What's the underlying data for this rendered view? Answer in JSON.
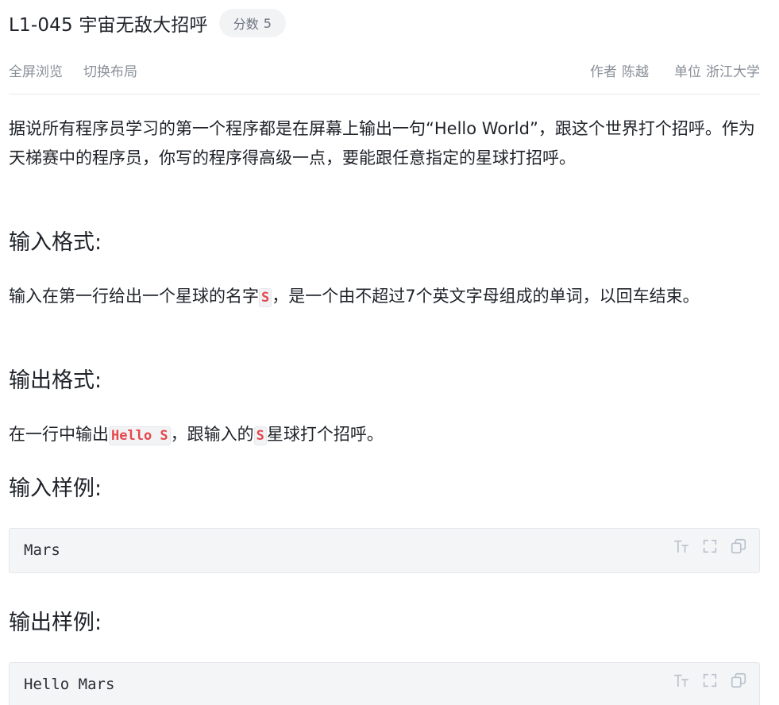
{
  "problem": {
    "title": "L1-045 宇宙无敌大招呼",
    "score_label": "分数",
    "score_value": "5"
  },
  "toolbar": {
    "fullscreen_label": "全屏浏览",
    "switch_layout_label": "切换布局"
  },
  "meta": {
    "author_label": "作者",
    "author_value": "陈越",
    "unit_label": "单位",
    "unit_value": "浙江大学"
  },
  "description": {
    "text": "据说所有程序员学习的第一个程序都是在屏幕上输出一句“Hello World”，跟这个世界打个招呼。作为天梯赛中的程序员，你写的程序得高级一点，要能跟任意指定的星球打招呼。"
  },
  "input_format": {
    "heading": "输入格式:",
    "text_before": "输入在第一行给出一个星球的名字",
    "code": "S",
    "text_after": "，是一个由不超过7个英文字母组成的单词，以回车结束。"
  },
  "output_format": {
    "heading": "输出格式:",
    "text_1": "在一行中输出",
    "code_1": "Hello S",
    "text_2": "，跟输入的",
    "code_2": "S",
    "text_3": "星球打个招呼。"
  },
  "sample_input": {
    "heading": "输入样例:",
    "code": "Mars"
  },
  "sample_output": {
    "heading": "输出样例:",
    "code": "Hello Mars"
  },
  "icons": {
    "font_size": "font-size-icon",
    "expand": "expand-icon",
    "copy": "copy-icon"
  },
  "colors": {
    "inline_code": "#e5484d",
    "icon": "#b8c2cc",
    "meta_text": "#8a9099"
  }
}
